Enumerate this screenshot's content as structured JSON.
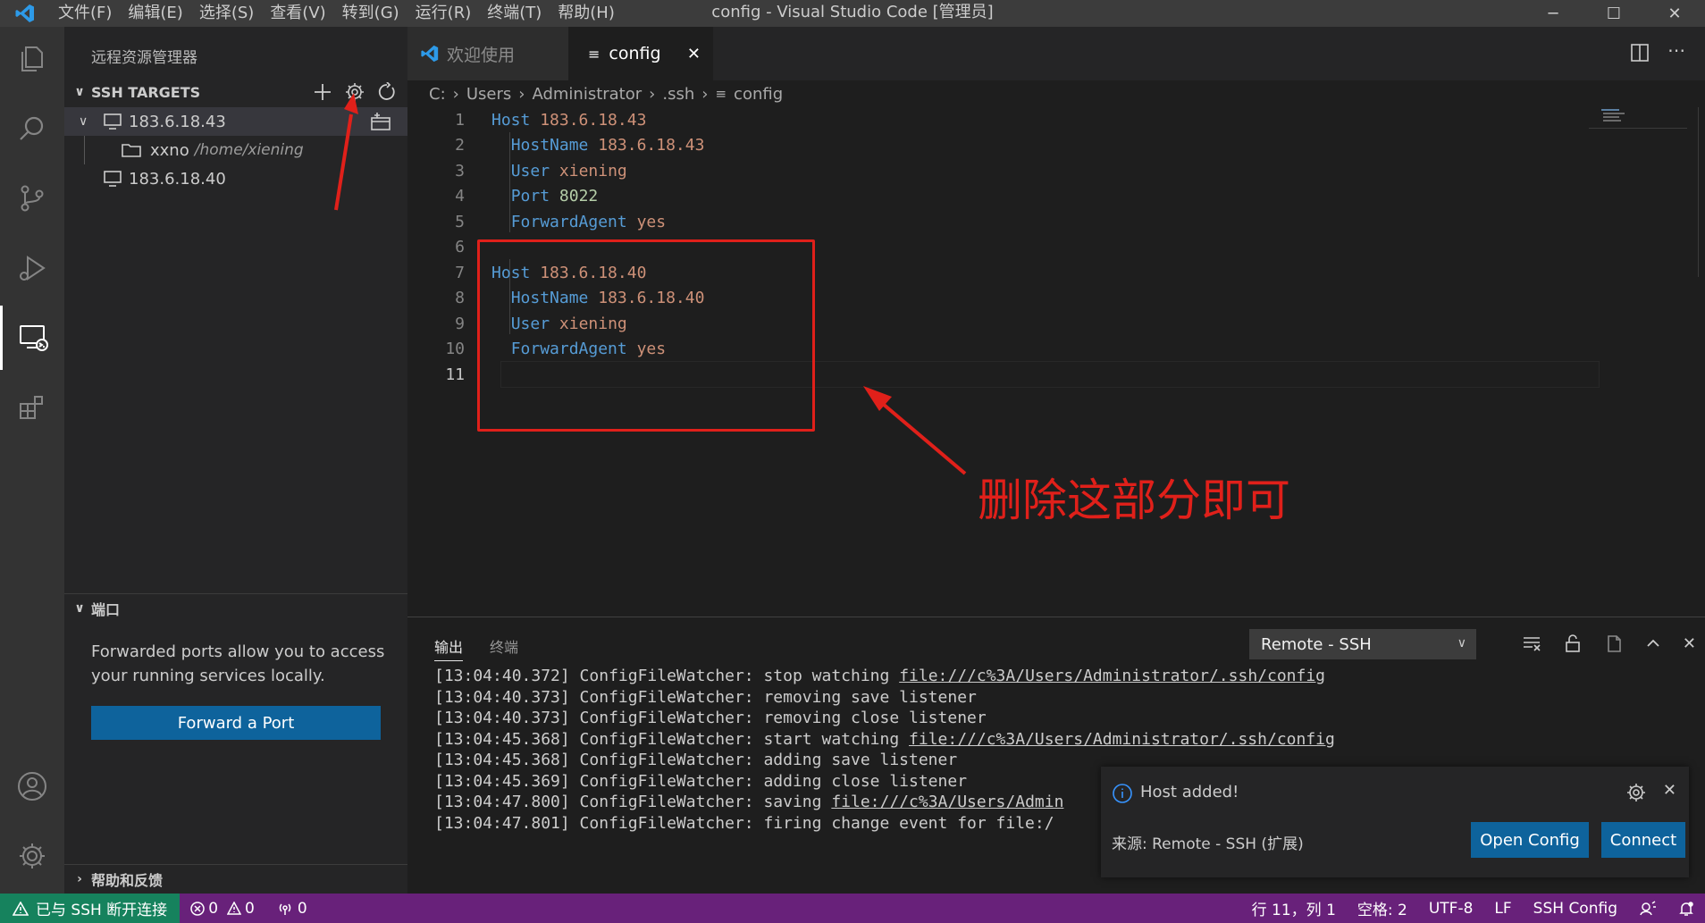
{
  "titlebar": {
    "menu": [
      "文件(F)",
      "编辑(E)",
      "选择(S)",
      "查看(V)",
      "转到(G)",
      "运行(R)",
      "终端(T)",
      "帮助(H)"
    ],
    "title": "config - Visual Studio Code [管理员]"
  },
  "sidebar": {
    "title": "远程资源管理器",
    "ssh_section": "SSH TARGETS",
    "hosts": [
      {
        "label": "183.6.18.43"
      },
      {
        "label": "183.6.18.40"
      }
    ],
    "folder": {
      "name": "xxno",
      "path": "/home/xiening"
    },
    "ports_section": "端口",
    "ports_text": "Forwarded ports allow you to access your running services locally.",
    "forward_button": "Forward a Port",
    "help_section": "帮助和反馈"
  },
  "tabs": {
    "welcome": "欢迎使用",
    "config": "config"
  },
  "breadcrumb": [
    "C:",
    "Users",
    "Administrator",
    ".ssh",
    "config"
  ],
  "code": [
    {
      "n": "1",
      "kw": "Host",
      "val": "183.6.18.43",
      "indent": false
    },
    {
      "n": "2",
      "kw": "HostName",
      "val": "183.6.18.43",
      "indent": true
    },
    {
      "n": "3",
      "kw": "User",
      "val": "xiening",
      "indent": true
    },
    {
      "n": "4",
      "kw": "Port",
      "val": "8022",
      "indent": true
    },
    {
      "n": "5",
      "kw": "ForwardAgent",
      "val": "yes",
      "indent": true
    },
    {
      "n": "6",
      "kw": "",
      "val": "",
      "indent": false
    },
    {
      "n": "7",
      "kw": "Host",
      "val": "183.6.18.40",
      "indent": false
    },
    {
      "n": "8",
      "kw": "HostName",
      "val": "183.6.18.40",
      "indent": true
    },
    {
      "n": "9",
      "kw": "User",
      "val": "xiening",
      "indent": true
    },
    {
      "n": "10",
      "kw": "ForwardAgent",
      "val": "yes",
      "indent": true
    },
    {
      "n": "11",
      "kw": "",
      "val": "",
      "indent": false
    }
  ],
  "panel": {
    "tab_output": "输出",
    "tab_terminal": "终端",
    "channel": "Remote - SSH",
    "lines": [
      {
        "ts": "[13:04:40.372]",
        "text": " ConfigFileWatcher: stop watching ",
        "link": "file:///c%3A/Users/Administrator/.ssh/config"
      },
      {
        "ts": "[13:04:40.373]",
        "text": " ConfigFileWatcher: removing save listener",
        "link": ""
      },
      {
        "ts": "[13:04:40.373]",
        "text": " ConfigFileWatcher: removing close listener",
        "link": ""
      },
      {
        "ts": "[13:04:45.368]",
        "text": " ConfigFileWatcher: start watching ",
        "link": "file:///c%3A/Users/Administrator/.ssh/config"
      },
      {
        "ts": "[13:04:45.368]",
        "text": " ConfigFileWatcher: adding save listener",
        "link": ""
      },
      {
        "ts": "[13:04:45.369]",
        "text": " ConfigFileWatcher: adding close listener",
        "link": ""
      },
      {
        "ts": "[13:04:47.800]",
        "text": " ConfigFileWatcher: saving ",
        "link": "file:///c%3A/Users/Admin"
      },
      {
        "ts": "[13:04:47.801]",
        "text": " ConfigFileWatcher: firing change event for file:/",
        "link": ""
      }
    ]
  },
  "toast": {
    "message": "Host added!",
    "source": "来源: Remote - SSH (扩展)",
    "open_config": "Open Config",
    "connect": "Connect"
  },
  "statusbar": {
    "remote": "已与 SSH 断开连接",
    "errors": "0",
    "warnings": "0",
    "ports": "0",
    "position": "行 11，列 1",
    "spaces": "空格: 2",
    "encoding": "UTF-8",
    "eol": "LF",
    "language": "SSH Config"
  },
  "annotation": {
    "text": "删除这部分即可",
    "color": "#e0201a"
  },
  "colors": {
    "accent": "#0e639c",
    "status_bg": "#68217a",
    "remote_bg": "#16825d"
  }
}
